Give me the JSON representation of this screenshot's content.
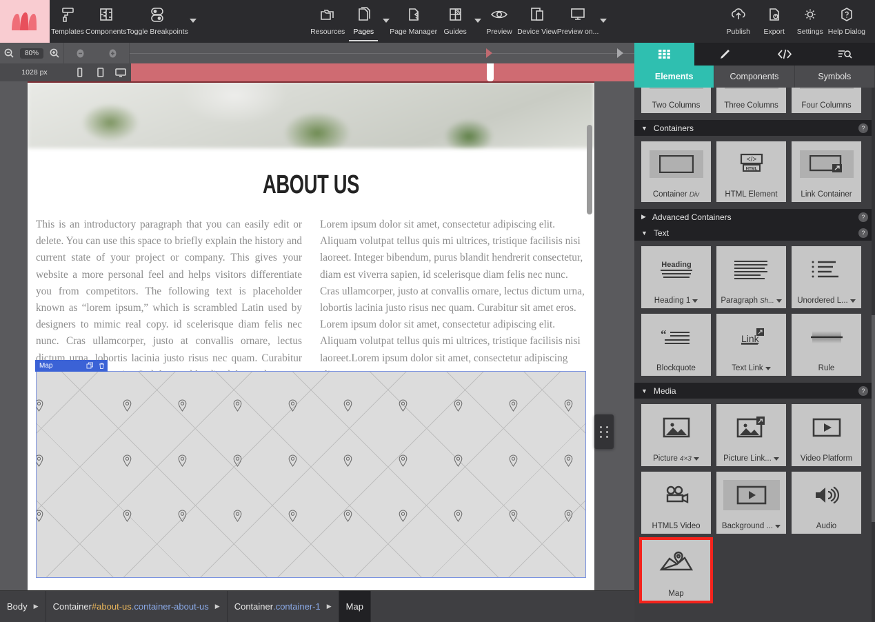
{
  "app": {
    "name": "Pinegrow",
    "logo": "pinegrow-logo"
  },
  "toolbar": {
    "items": [
      {
        "label": "Templates",
        "icon": "paint-roller-icon",
        "caret": false,
        "active": false
      },
      {
        "label": "Components",
        "icon": "puzzle-icon",
        "caret": false,
        "active": false
      },
      {
        "label": "Toggle Breakpoints",
        "icon": "breakpoints-icon",
        "caret": true,
        "active": false
      },
      {
        "label": "Resources",
        "icon": "folders-icon",
        "caret": false,
        "active": false
      },
      {
        "label": "Pages",
        "icon": "pages-icon",
        "caret": true,
        "active": true
      },
      {
        "label": "Page Manager",
        "icon": "page-manager-icon",
        "caret": false,
        "active": false
      },
      {
        "label": "Guides",
        "icon": "guides-icon",
        "caret": true,
        "active": false
      },
      {
        "label": "Preview",
        "icon": "eye-icon",
        "caret": false,
        "active": false
      },
      {
        "label": "Device View",
        "icon": "device-view-icon",
        "caret": false,
        "active": false
      },
      {
        "label": "Preview on...",
        "icon": "monitor-icon",
        "caret": true,
        "active": false
      }
    ],
    "right_items": [
      {
        "label": "Publish",
        "icon": "cloud-upload-icon"
      },
      {
        "label": "Export",
        "icon": "export-file-icon"
      },
      {
        "label": "Settings",
        "icon": "gear-icon"
      },
      {
        "label": "Help Dialog",
        "icon": "help-question-icon"
      }
    ]
  },
  "zoombar": {
    "zoom_out_icon": "magnifier-minus-icon",
    "zoom_level": "80%",
    "zoom_in_icon": "magnifier-plus-icon",
    "minus_icon": "circle-minus-icon",
    "plus_icon": "circle-plus-icon",
    "breakpoint_markers": [
      {
        "x_pct": 32,
        "color": "#c06a70"
      },
      {
        "x_pct": 73,
        "color": "#a8a8ab"
      },
      {
        "x_pct": 106,
        "color": "#bf5f66"
      }
    ]
  },
  "devicebar": {
    "width_label": "1028 px",
    "devices": [
      {
        "icon": "phone-icon",
        "active": false
      },
      {
        "icon": "tablet-icon",
        "active": false
      },
      {
        "icon": "desktop-icon",
        "active": true
      }
    ],
    "bar_color": "#cf6b72",
    "handle_position_pct": 89
  },
  "canvas": {
    "page": {
      "heading": "ABOUT US",
      "left_column": "This is an introductory paragraph that you can easily edit or delete. You can use this space to briefly explain the history and current state of your project or company. This gives your website a more personal feel and helps visitors differentiate you from competitors. The following text is placeholder known as “lorem ipsum,” which is scrambled Latin used by designers to mimic real copy. id scelerisque diam felis nec nunc. Cras ullamcorper, justo at convallis ornare, lectus dictum urna, lobortis lacinia justo risus nec quam. Curabitur sit amet eros mauris. Sed luctus blandit dolor sed cursus. Lorem ipsum dolor sit amet, consectetur adipiscing elit.",
      "right_column": "Lorem ipsum dolor sit amet, consectetur adipiscing elit. Aliquam volutpat tellus quis mi ultrices, tristique facilisis nisi laoreet. Integer bibendum, purus blandit hendrerit consectetur, diam est viverra sapien, id scelerisque diam felis nec nunc. Cras ullamcorper, justo at convallis ornare, lectus dictum urna, lobortis lacinia justo risus nec quam. Curabitur sit amet eros. Lorem ipsum dolor sit amet, consectetur adipiscing elit. Aliquam volutpat tellus quis mi ultrices, tristique facilisis nisi laoreet.Lorem ipsum dolor sit amet, consectetur adipiscing elit."
    },
    "selected_element": {
      "badge_label": "Map",
      "badge_color": "#3b62d6",
      "duplicate_icon": "duplicate-icon",
      "delete_icon": "trash-icon",
      "selection_border_color": "#7b93e0"
    },
    "drag_handle_icon": "drag-dots-icon"
  },
  "breadcrumb": {
    "items": [
      {
        "tag": "Body",
        "hash": "",
        "cls": "",
        "arrow": true,
        "selected": false
      },
      {
        "tag": "Container",
        "hash": "#about-us",
        "cls": ".container-about-us",
        "arrow": true,
        "selected": false
      },
      {
        "tag": "Container",
        "hash": "",
        "cls": ".container-1",
        "arrow": true,
        "selected": false
      },
      {
        "tag": "Map",
        "hash": "",
        "cls": "",
        "arrow": false,
        "selected": true
      }
    ]
  },
  "panel": {
    "icon_tabs": [
      {
        "icon": "grid-icon",
        "active": true
      },
      {
        "icon": "brush-icon",
        "active": false
      },
      {
        "icon": "code-icon",
        "active": false
      },
      {
        "icon": "list-search-icon",
        "active": false
      }
    ],
    "tabs": [
      {
        "label": "Elements",
        "active": true
      },
      {
        "label": "Components",
        "active": false
      },
      {
        "label": "Symbols",
        "active": false
      }
    ],
    "groups": [
      {
        "name": "",
        "header": false,
        "expanded": true,
        "tiles": [
          {
            "label": "Two Columns",
            "icon": "two-columns-icon",
            "sub": "",
            "dropdown": false,
            "highlight": false
          },
          {
            "label": "Three Columns",
            "icon": "three-columns-icon",
            "sub": "",
            "dropdown": false,
            "highlight": false
          },
          {
            "label": "Four Columns",
            "icon": "four-columns-icon",
            "sub": "",
            "dropdown": false,
            "highlight": false
          }
        ]
      },
      {
        "name": "Containers",
        "header": true,
        "expanded": true,
        "help": "?",
        "tiles": [
          {
            "label": "Container",
            "icon": "container-rect-icon",
            "sub": "Div",
            "dropdown": false,
            "highlight": false
          },
          {
            "label": "HTML Element",
            "icon": "html-element-icon",
            "sub": "",
            "dropdown": false,
            "highlight": false
          },
          {
            "label": "Link Container",
            "icon": "link-container-icon",
            "sub": "",
            "dropdown": false,
            "highlight": false
          }
        ]
      },
      {
        "name": "Advanced Containers",
        "header": true,
        "expanded": false,
        "help": "?",
        "tiles": []
      },
      {
        "name": "Text",
        "header": true,
        "expanded": true,
        "help": "?",
        "tiles": [
          {
            "label": "Heading 1",
            "icon": "heading-icon",
            "sub": "",
            "dropdown": true,
            "highlight": false
          },
          {
            "label": "Paragraph",
            "icon": "paragraph-icon",
            "sub": "Sh...",
            "dropdown": true,
            "highlight": false
          },
          {
            "label": "Unordered L...",
            "icon": "unordered-list-icon",
            "sub": "",
            "dropdown": true,
            "highlight": false
          },
          {
            "label": "Blockquote",
            "icon": "blockquote-icon",
            "sub": "",
            "dropdown": false,
            "highlight": false
          },
          {
            "label": "Text Link",
            "icon": "text-link-icon",
            "sub": "",
            "dropdown": true,
            "highlight": false
          },
          {
            "label": "Rule",
            "icon": "rule-icon",
            "sub": "",
            "dropdown": false,
            "highlight": false
          }
        ]
      },
      {
        "name": "Media",
        "header": true,
        "expanded": true,
        "help": "?",
        "tiles": [
          {
            "label": "Picture",
            "icon": "picture-icon",
            "sub": "4×3",
            "dropdown": true,
            "highlight": false
          },
          {
            "label": "Picture Link...",
            "icon": "picture-link-icon",
            "sub": "",
            "dropdown": true,
            "highlight": false
          },
          {
            "label": "Video Platform",
            "icon": "video-platform-icon",
            "sub": "",
            "dropdown": false,
            "highlight": false
          },
          {
            "label": "HTML5 Video",
            "icon": "html5-video-icon",
            "sub": "",
            "dropdown": false,
            "highlight": false
          },
          {
            "label": "Background ...",
            "icon": "background-video-icon",
            "sub": "",
            "dropdown": true,
            "highlight": false
          },
          {
            "label": "Audio",
            "icon": "audio-icon",
            "sub": "",
            "dropdown": false,
            "highlight": false
          },
          {
            "label": "Map",
            "icon": "map-icon",
            "sub": "",
            "dropdown": false,
            "highlight": true
          }
        ]
      }
    ]
  },
  "colors": {
    "accent_teal": "#2fbfb0",
    "highlight_red": "#f4231c",
    "selection_blue": "#3b62d6",
    "logo_pink": "#f9ccd1",
    "progress_red": "#cf6b72"
  }
}
